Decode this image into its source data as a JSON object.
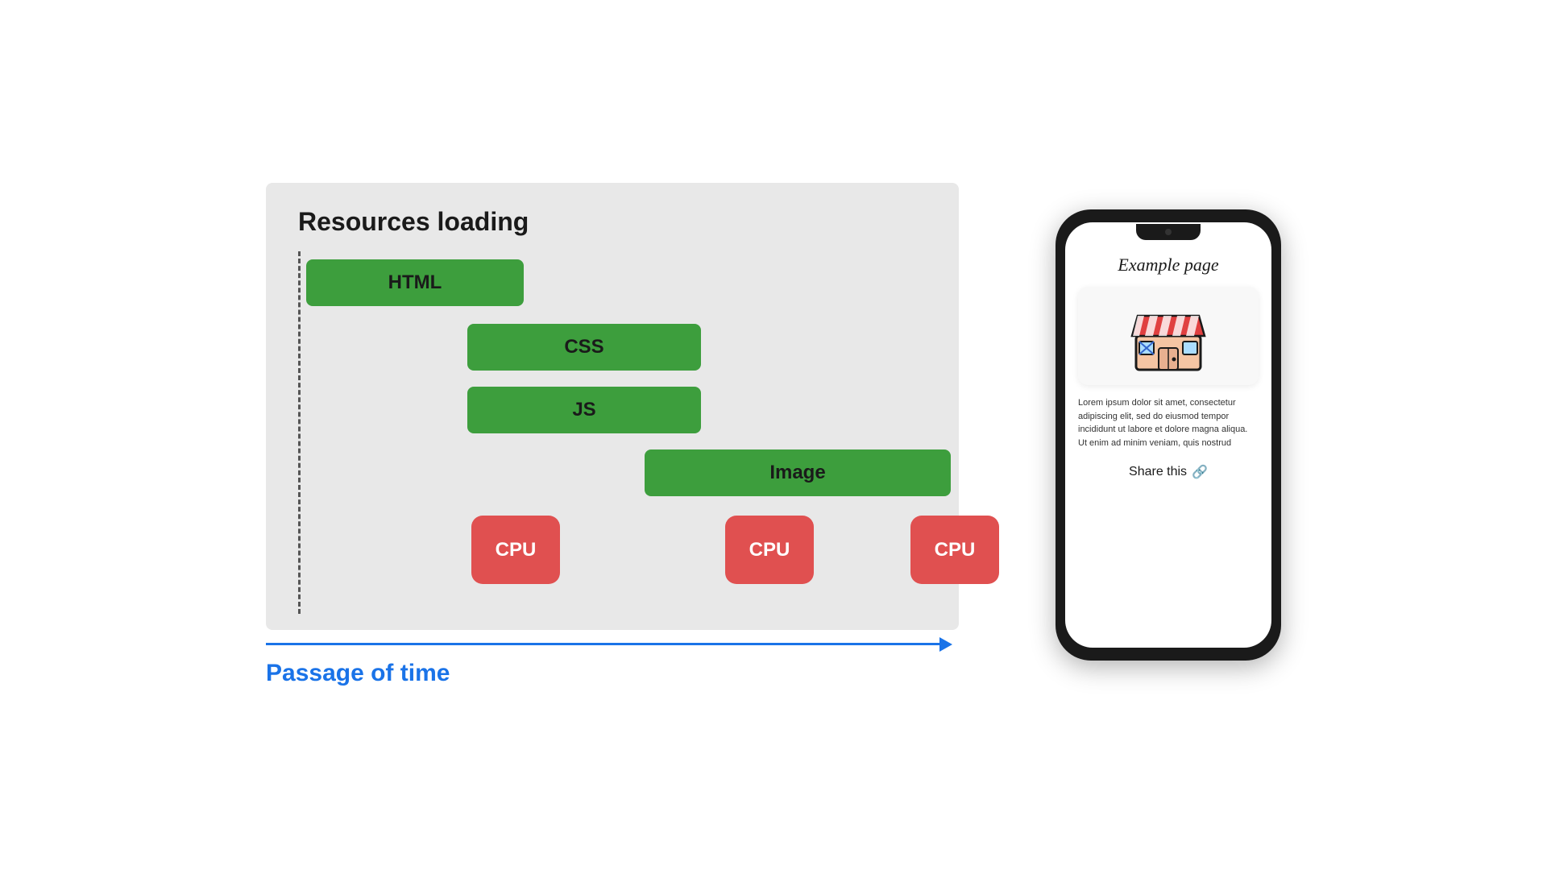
{
  "diagram": {
    "title": "Resources loading",
    "bars": [
      {
        "label": "HTML"
      },
      {
        "label": "CSS"
      },
      {
        "label": "JS"
      },
      {
        "label": "Image"
      }
    ],
    "cpu_labels": [
      "CPU",
      "CPU",
      "CPU"
    ],
    "time_label": "Passage of time"
  },
  "phone": {
    "page_title": "Example page",
    "body_text": "Lorem ipsum dolor sit amet, consectetur adipiscing elit, sed do eiusmod tempor incididunt ut labore et dolore magna aliqua. Ut enim ad minim veniam, quis nostrud",
    "share_text": "Share this",
    "link_icon": "🔗"
  }
}
